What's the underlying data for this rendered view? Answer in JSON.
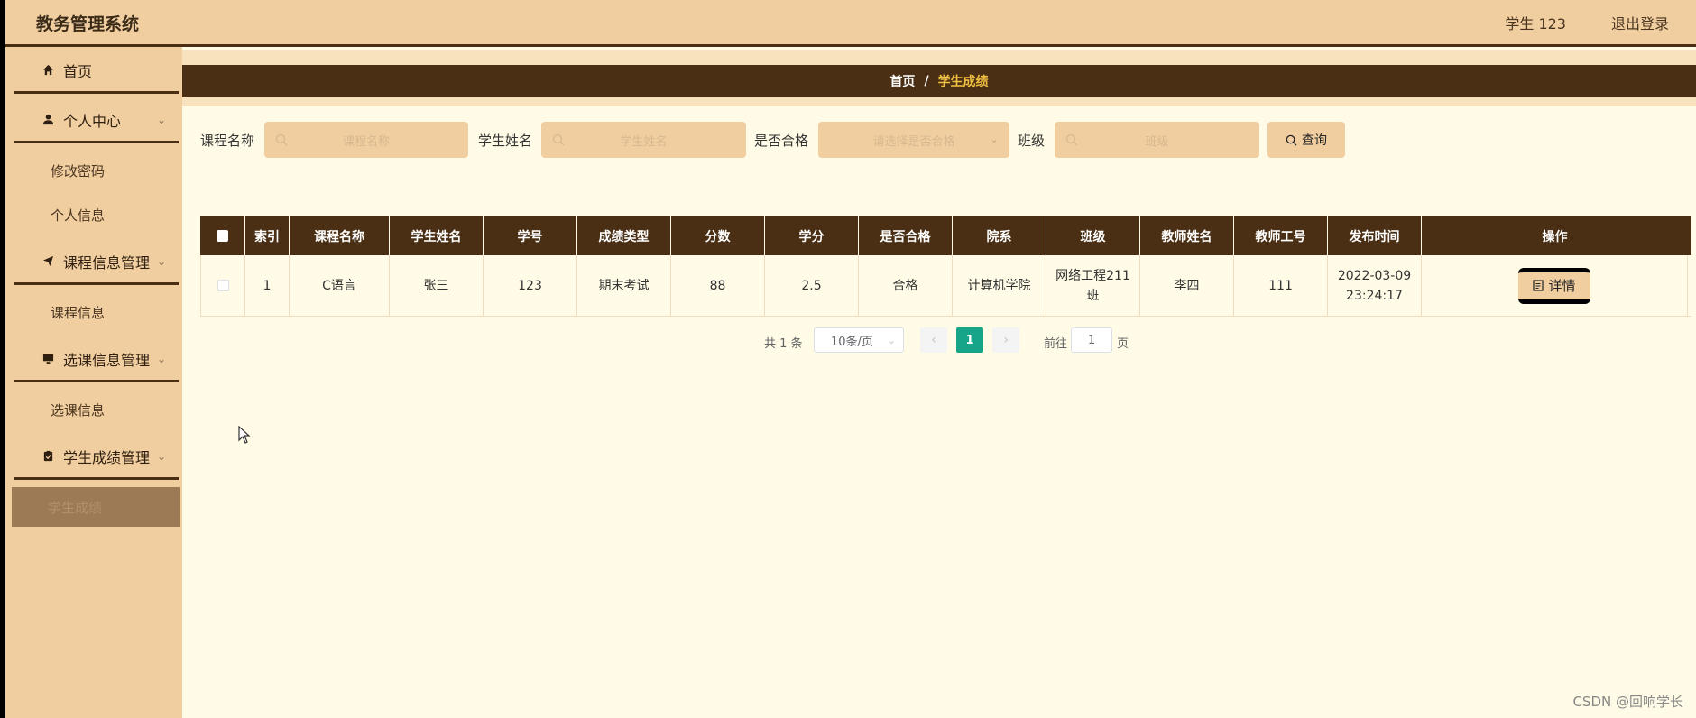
{
  "app": {
    "title": "教务管理系统"
  },
  "header": {
    "user": "学生 123",
    "logout": "退出登录"
  },
  "sidebar": {
    "items": [
      {
        "label": "首页",
        "icon": "home-icon"
      },
      {
        "label": "个人中心",
        "icon": "user-icon",
        "children": [
          "修改密码",
          "个人信息"
        ]
      },
      {
        "label": "课程信息管理",
        "icon": "send-icon",
        "children": [
          "课程信息"
        ]
      },
      {
        "label": "选课信息管理",
        "icon": "monitor-icon",
        "children": [
          "选课信息"
        ]
      },
      {
        "label": "学生成绩管理",
        "icon": "clipboard-icon",
        "children": [
          "学生成绩"
        ]
      }
    ]
  },
  "breadcrumb": {
    "home": "首页",
    "separator": "/",
    "current": "学生成绩"
  },
  "search": {
    "course_label": "课程名称",
    "course_placeholder": "课程名称",
    "student_label": "学生姓名",
    "student_placeholder": "学生姓名",
    "pass_label": "是否合格",
    "pass_placeholder": "请选择是否合格",
    "class_label": "班级",
    "class_placeholder": "班级",
    "query_label": "查询"
  },
  "table": {
    "headers": [
      "索引",
      "课程名称",
      "学生姓名",
      "学号",
      "成绩类型",
      "分数",
      "学分",
      "是否合格",
      "院系",
      "班级",
      "教师姓名",
      "教师工号",
      "发布时间",
      "操作"
    ],
    "rows": [
      {
        "index": "1",
        "course": "C语言",
        "student": "张三",
        "student_no": "123",
        "grade_type": "期末考试",
        "score": "88",
        "credit": "2.5",
        "passed": "合格",
        "department": "计算机学院",
        "class_line1": "网络工程211",
        "class_line2": "班",
        "teacher": "李四",
        "teacher_no": "111",
        "date": "2022-03-09",
        "time": "23:24:17",
        "action": "详情"
      }
    ]
  },
  "pagination": {
    "total": "共 1 条",
    "page_size": "10条/页",
    "current": "1",
    "goto": "前往",
    "goto_value": "1",
    "page_unit": "页"
  },
  "watermark": "CSDN @回响学长",
  "colors": {
    "accent": "#4a2f14",
    "panel": "#f0cea0",
    "background": "#fffbe6",
    "pager_active": "#17a589"
  }
}
